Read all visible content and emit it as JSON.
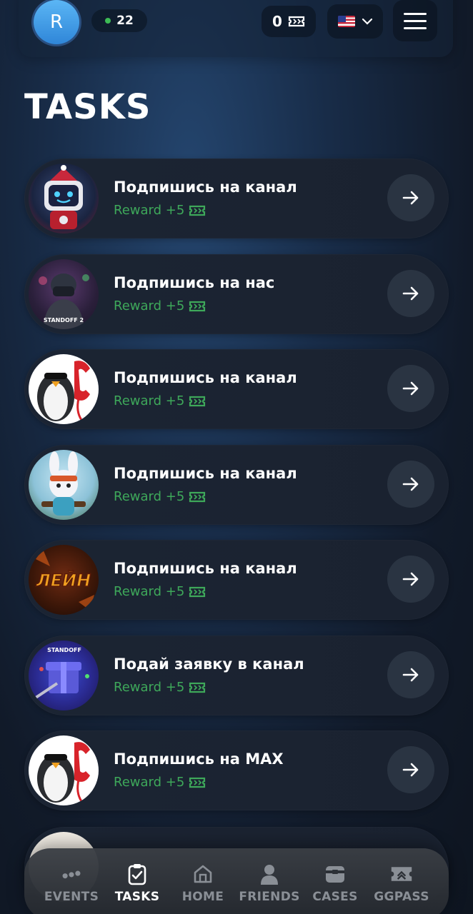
{
  "header": {
    "avatar_letter": "R",
    "online_count": "22",
    "tickets_count": "0",
    "language_icon": "us-flag-icon",
    "menu_icon": "hamburger-icon"
  },
  "page": {
    "title": "TASKS"
  },
  "tasks": [
    {
      "title": "Подпишись на канал",
      "reward": "Reward +5",
      "thumb": "robot-avatar"
    },
    {
      "title": "Подпишись на нас",
      "reward": "Reward +5",
      "thumb": "standoff2-soldier",
      "thumb_text": "STANDOFF 2"
    },
    {
      "title": "Подпишись на канал",
      "reward": "Reward +5",
      "thumb": "penguin-phone"
    },
    {
      "title": "Подпишись на канал",
      "reward": "Reward +5",
      "thumb": "bunny-gunner"
    },
    {
      "title": "Подпишись на канал",
      "reward": "Reward +5",
      "thumb": "lein-logo",
      "thumb_text": "ЛЕЙН"
    },
    {
      "title": "Подай заявку в канал",
      "reward": "Reward +5",
      "thumb": "standoff-gift",
      "thumb_text": "STANDOFF"
    },
    {
      "title": "Подпишись на MAX",
      "reward": "Reward +5",
      "thumb": "penguin-phone"
    }
  ],
  "nav": {
    "items": [
      {
        "label": "EVENTS",
        "icon": "events-icon"
      },
      {
        "label": "TASKS",
        "icon": "clipboard-check-icon",
        "active": true
      },
      {
        "label": "HOME",
        "icon": "home-icon"
      },
      {
        "label": "FRIENDS",
        "icon": "person-icon"
      },
      {
        "label": "CASES",
        "icon": "case-icon"
      },
      {
        "label": "GGPASS",
        "icon": "ggpass-icon"
      }
    ]
  },
  "colors": {
    "reward_green": "#3ea85a",
    "online_green": "#3dbb55",
    "avatar_blue": "#4aa6ee"
  }
}
